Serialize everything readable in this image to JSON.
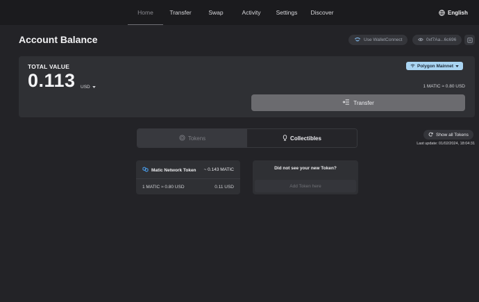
{
  "nav": {
    "items": [
      {
        "label": "Home"
      },
      {
        "label": "Transfer"
      },
      {
        "label": "Swap"
      },
      {
        "label": "Activity"
      },
      {
        "label": "Settings"
      },
      {
        "label": "Discover"
      }
    ],
    "active": "Home",
    "language": "English",
    "language_icon": "globe-icon"
  },
  "header": {
    "title": "Account Balance",
    "walletconnect_label": "Use WalletConnect",
    "address": "0xf7Aa...6c696"
  },
  "balance": {
    "total_label": "TOTAL VALUE",
    "total_value": "0.113",
    "currency": "USD",
    "network": "Polygon Mainnet",
    "rate": "1 MATIC ≈ 0.80 USD",
    "transfer_label": "Transfer"
  },
  "tabs": [
    {
      "label": "Tokens",
      "icon": "coin-icon"
    },
    {
      "label": "Collectibles",
      "icon": "collectible-icon"
    }
  ],
  "active_tab": "Collectibles",
  "show_all_label": "Show all Tokens",
  "last_update": "Last update: 01/02/2024, 18:04:31",
  "token": {
    "name": "Matic Network Token",
    "amount": "~ 0.143 MATIC",
    "rate": "1 MATIC ≈ 0.80 USD",
    "usd_value": "0.11 USD"
  },
  "new_token": {
    "question": "Did not see your new Token?",
    "add_label": "Add Token here"
  },
  "colors": {
    "background": "#232327",
    "topbar": "#1b1b1e",
    "card": "#2f3034",
    "network_pill": "#a9d4f2",
    "polygon_logo": "#8247e5"
  }
}
